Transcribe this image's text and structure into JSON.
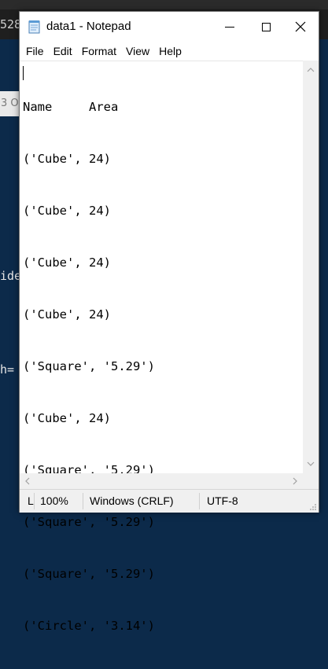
{
  "background": {
    "fragments": [
      "528",
      "3 O",
      "ide",
      "h="
    ]
  },
  "window": {
    "title": "data1 - Notepad",
    "menu": [
      "File",
      "Edit",
      "Format",
      "View",
      "Help"
    ],
    "content_lines": [
      "Name     Area",
      "('Cube', 24)",
      "('Cube', 24)",
      "('Cube', 24)",
      "('Cube', 24)",
      "('Square', '5.29')",
      "('Cube', 24)",
      "('Square', '5.29')",
      "('Square', '5.29')",
      "('Square', '5.29')",
      "('Circle', '3.14')"
    ],
    "status": {
      "position": "L",
      "zoom": "100%",
      "line_ending": "Windows (CRLF)",
      "encoding": "UTF-8"
    }
  }
}
